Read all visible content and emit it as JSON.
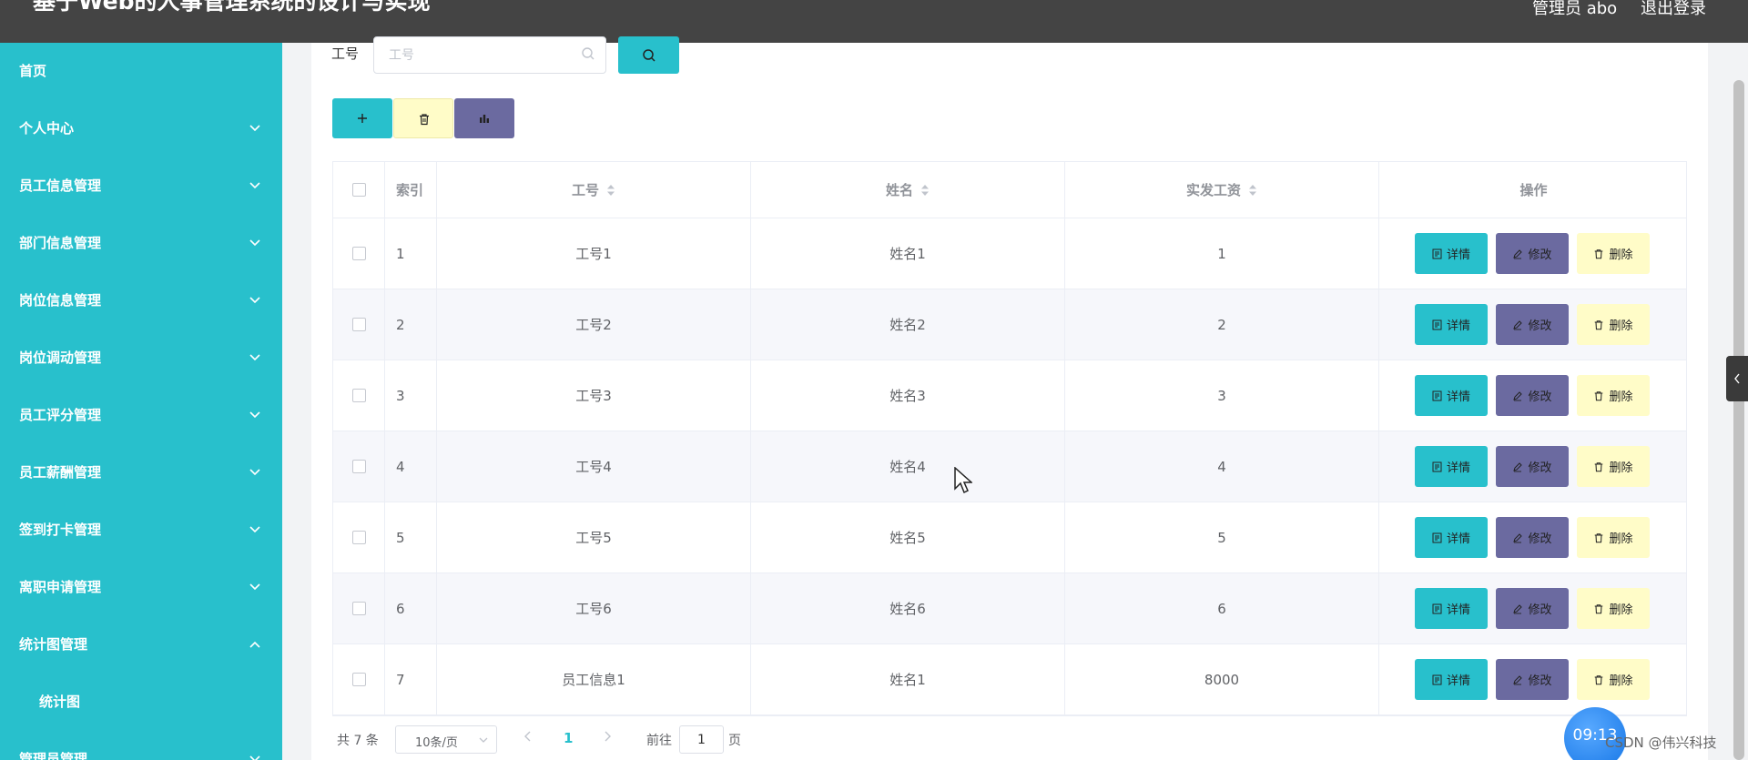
{
  "header": {
    "title": "基于Web的人事管理系统的设计与实现",
    "user": "管理员 abo",
    "logout": "退出登录"
  },
  "sidebar": {
    "items": [
      {
        "label": "首页",
        "has_arrow": false
      },
      {
        "label": "个人中心",
        "has_arrow": true
      },
      {
        "label": "员工信息管理",
        "has_arrow": true
      },
      {
        "label": "部门信息管理",
        "has_arrow": true
      },
      {
        "label": "岗位信息管理",
        "has_arrow": true
      },
      {
        "label": "岗位调动管理",
        "has_arrow": true
      },
      {
        "label": "员工评分管理",
        "has_arrow": true
      },
      {
        "label": "员工薪酬管理",
        "has_arrow": true
      },
      {
        "label": "签到打卡管理",
        "has_arrow": true
      },
      {
        "label": "离职申请管理",
        "has_arrow": true
      },
      {
        "label": "统计图管理",
        "has_arrow": true,
        "expanded": true
      },
      {
        "label": "统计图",
        "sub": true
      },
      {
        "label": "管理员管理",
        "has_arrow": true
      }
    ]
  },
  "search": {
    "label": "工号",
    "placeholder": "工号"
  },
  "table": {
    "headers": {
      "index": "索引",
      "no": "工号",
      "name": "姓名",
      "salary": "实发工资",
      "ops": "操作"
    },
    "rows": [
      {
        "index": "1",
        "no": "工号1",
        "name": "姓名1",
        "salary": "1"
      },
      {
        "index": "2",
        "no": "工号2",
        "name": "姓名2",
        "salary": "2"
      },
      {
        "index": "3",
        "no": "工号3",
        "name": "姓名3",
        "salary": "3"
      },
      {
        "index": "4",
        "no": "工号4",
        "name": "姓名4",
        "salary": "4"
      },
      {
        "index": "5",
        "no": "工号5",
        "name": "姓名5",
        "salary": "5"
      },
      {
        "index": "6",
        "no": "工号6",
        "name": "姓名6",
        "salary": "6"
      },
      {
        "index": "7",
        "no": "员工信息1",
        "name": "姓名1",
        "salary": "8000"
      }
    ],
    "actions": {
      "detail": "详情",
      "edit": "修改",
      "delete": "删除"
    }
  },
  "pagination": {
    "total": "共 7 条",
    "page_size": "10条/页",
    "current": "1",
    "goto_prefix": "前往",
    "goto_value": "1",
    "goto_suffix": "页"
  },
  "overlay": {
    "clock": "09:13",
    "watermark": "CSDN @伟兴科技"
  },
  "colors": {
    "accent": "#28c0cc",
    "purple": "#6b6aa0",
    "yellow": "#fffcc8",
    "header": "#444444"
  },
  "icons": [
    "search-icon",
    "plus-icon",
    "trash-icon",
    "bar-chart-icon",
    "document-icon",
    "edit-icon",
    "chevron-down-icon",
    "chevron-up-icon",
    "chevron-left-icon",
    "chevron-right-icon",
    "sort-icon",
    "cursor-icon"
  ]
}
